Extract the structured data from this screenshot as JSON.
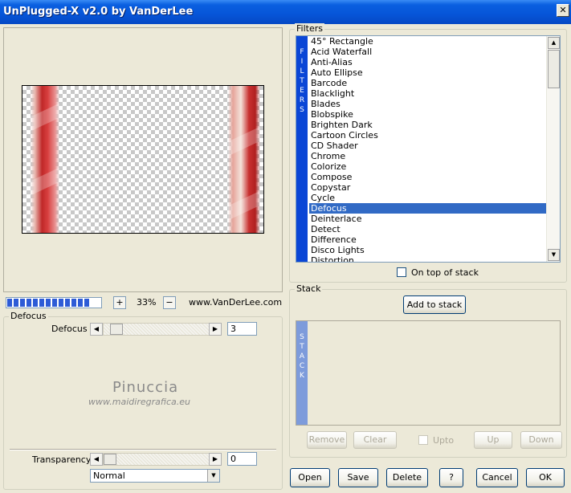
{
  "window": {
    "title": "UnPlugged-X v2.0 by VanDerLee",
    "close_symbol": "✕"
  },
  "preview": {
    "zoom": "33%",
    "website": "www.VanDerLee.com",
    "plus": "+",
    "minus": "−",
    "progress_segments": 13
  },
  "defocus_group": {
    "legend": "Defocus",
    "param_label": "Defocus",
    "param_value": "3",
    "watermark_name": "Pinuccia",
    "watermark_url": "www.maidiregrafica.eu",
    "transparency_label": "Transparency",
    "transparency_value": "0",
    "blend_mode": "Normal"
  },
  "filters_group": {
    "legend": "Filters",
    "sidebar_letters": [
      "F",
      "I",
      "L",
      "T",
      "E",
      "R",
      "S"
    ],
    "items": [
      "45° Rectangle",
      "Acid Waterfall",
      "Anti-Alias",
      "Auto Ellipse",
      "Barcode",
      "Blacklight",
      "Blades",
      "Blobspike",
      "Brighten Dark",
      "Cartoon Circles",
      "CD Shader",
      "Chrome",
      "Colorize",
      "Compose",
      "Copystar",
      "Cycle",
      "Defocus",
      "Deinterlace",
      "Detect",
      "Difference",
      "Disco Lights",
      "Distortion"
    ],
    "selected": "Defocus",
    "on_top_label": "On top of stack"
  },
  "stack_group": {
    "legend": "Stack",
    "add_label": "Add to stack",
    "sidebar_letters": [
      "S",
      "T",
      "A",
      "C",
      "K"
    ],
    "remove_label": "Remove",
    "clear_label": "Clear",
    "upto_label": "Upto",
    "up_label": "Up",
    "down_label": "Down"
  },
  "footer": {
    "open": "Open",
    "save": "Save",
    "delete": "Delete",
    "help": "?",
    "cancel": "Cancel",
    "ok": "OK"
  },
  "colors": {
    "titlebar": "#0655d8",
    "selection": "#316ac5",
    "filters_bar": "#0a46d6",
    "stack_bar": "#7d9bdb"
  }
}
